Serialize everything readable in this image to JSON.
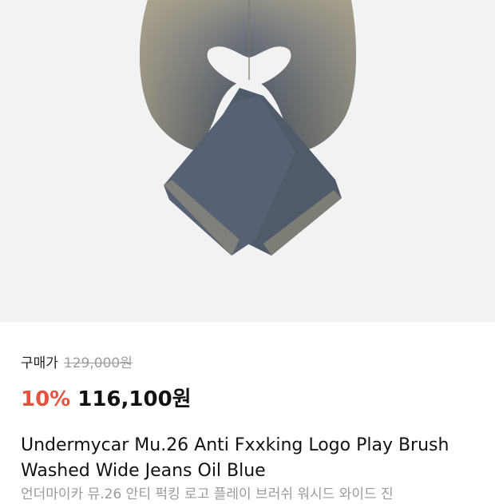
{
  "product": {
    "image_alt": "jeans-photo",
    "buy_label": "구매가",
    "original_price": "129,000원",
    "discount": "10%",
    "sale_price": "116,100원",
    "title": "Undermycar Mu.26 Anti Fxxking Logo Play Brush Washed Wide Jeans Oil Blue",
    "subtitle": "언더마이카 뮤.26 안티 퍽킹 로고 플레이 브러쉬 워시드 와이드 진"
  },
  "colors": {
    "discount": "#e5533f",
    "hero_bg": "#f2f2f2"
  }
}
